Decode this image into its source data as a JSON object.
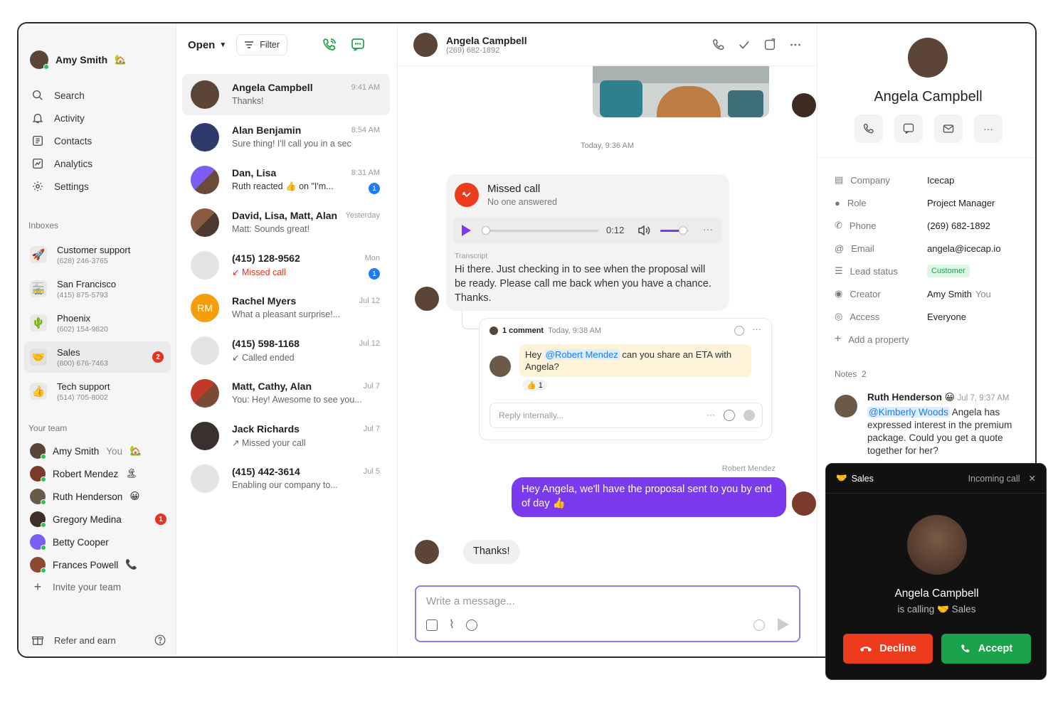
{
  "user": {
    "name": "Amy Smith",
    "status_emoji": "🏡"
  },
  "nav": {
    "items": [
      {
        "label": "Search",
        "icon": "search-icon"
      },
      {
        "label": "Activity",
        "icon": "bell-icon"
      },
      {
        "label": "Contacts",
        "icon": "contacts-icon"
      },
      {
        "label": "Analytics",
        "icon": "analytics-icon"
      },
      {
        "label": "Settings",
        "icon": "gear-icon"
      }
    ],
    "inboxes_label": "Inboxes",
    "inboxes": [
      {
        "name": "Customer support",
        "number": "(628) 246-3765",
        "emoji": "🚀"
      },
      {
        "name": "San Francisco",
        "number": "(415) 875-5793",
        "emoji": "🚋"
      },
      {
        "name": "Phoenix",
        "number": "(602) 154-9820",
        "emoji": "🌵"
      },
      {
        "name": "Sales",
        "number": "(800) 676-7463",
        "emoji": "🤝",
        "badge": "2"
      },
      {
        "name": "Tech support",
        "number": "(514) 705-8002",
        "emoji": "👍"
      }
    ],
    "team_label": "Your team",
    "team": [
      {
        "name": "Amy Smith",
        "suffix": "You",
        "emoji": "🏡"
      },
      {
        "name": "Robert Mendez",
        "emoji": "🏝"
      },
      {
        "name": "Ruth Henderson",
        "emoji": "😀"
      },
      {
        "name": "Gregory Medina",
        "badge": "1"
      },
      {
        "name": "Betty Cooper"
      },
      {
        "name": "Frances Powell",
        "emoji": "📞"
      }
    ],
    "invite_label": "Invite your team",
    "refer_label": "Refer and earn"
  },
  "list": {
    "filter_dropdown": "Open",
    "filter_button": "Filter",
    "conversations": [
      {
        "title": "Angela Campbell",
        "time": "9:41 AM",
        "preview": "Thanks!"
      },
      {
        "title": "Alan Benjamin",
        "time": "8:54 AM",
        "preview": "Sure thing! I'll call you in a sec"
      },
      {
        "title": "Dan, Lisa",
        "time": "8:31 AM",
        "preview": "Ruth reacted 👍 on \"I'm...",
        "badge": "1"
      },
      {
        "title": "David, Lisa, Matt, Alan",
        "time": "Yesterday",
        "preview": "Matt: Sounds great!"
      },
      {
        "title": "(415) 128-9562",
        "time": "Mon",
        "preview": "Missed call",
        "badge": "1"
      },
      {
        "title": "Rachel Myers",
        "time": "Jul 12",
        "preview": "What a pleasant surprise!...",
        "initials": "RM"
      },
      {
        "title": "(415) 598-1168",
        "time": "Jul 12",
        "preview": "Called ended"
      },
      {
        "title": "Matt, Cathy, Alan",
        "time": "Jul 7",
        "preview": "You: Hey! Awesome to see you..."
      },
      {
        "title": "Jack Richards",
        "time": "Jul 7",
        "preview": "Missed your call"
      },
      {
        "title": "(415) 442-3614",
        "time": "Jul 5",
        "preview": "Enabling our company to..."
      }
    ]
  },
  "chat": {
    "contact_name": "Angela Campbell",
    "contact_phone": "(269) 682-1892",
    "timestamp": "Today, 9:36 AM",
    "missed_call": {
      "title": "Missed call",
      "subtitle": "No one answered",
      "duration": "0:12",
      "progress": 0,
      "volume": 0.8,
      "transcript_label": "Transcript",
      "transcript": "Hi there. Just checking in to see when the proposal will be ready. Please call me back when you have a chance. Thanks."
    },
    "comment": {
      "count_label": "1 comment",
      "time": "Today, 9:38 AM",
      "text_pre": "Hey ",
      "mention": "@Robert Mendez",
      "text_post": " can you share an ETA with Angela?",
      "reaction": "👍 1",
      "reply_placeholder": "Reply internally..."
    },
    "sender_label": "Robert Mendez",
    "outgoing": "Hey Angela, we'll have the proposal sent to you by end of day 👍",
    "incoming": "Thanks!",
    "composer_placeholder": "Write a message..."
  },
  "details": {
    "name": "Angela Campbell",
    "properties": [
      {
        "key": "Company",
        "value": "Icecap",
        "icon": "building-icon"
      },
      {
        "key": "Role",
        "value": "Project Manager",
        "icon": "person-icon"
      },
      {
        "key": "Phone",
        "value": "(269) 682-1892",
        "icon": "phone-icon"
      },
      {
        "key": "Email",
        "value": "angela@icecap.io",
        "icon": "at-icon"
      },
      {
        "key": "Lead status",
        "value": "Customer",
        "icon": "list-icon"
      },
      {
        "key": "Creator",
        "value": "Amy Smith",
        "value_suffix": "You",
        "icon": "creator-icon"
      },
      {
        "key": "Access",
        "value": "Everyone",
        "icon": "eye-icon"
      }
    ],
    "add_property": "Add a property",
    "notes_label": "Notes",
    "notes_count": "2",
    "note": {
      "author": "Ruth Henderson",
      "emoji": "😀",
      "time": "Jul 7, 9:37 AM",
      "mention": "@Kimberly Woods",
      "text": " Angela has expressed interest in the premium package. Could you get a quote together for her?"
    }
  },
  "incoming_call": {
    "inbox": "Sales",
    "inbox_emoji": "🤝",
    "label": "Incoming call",
    "caller": "Angela Campbell",
    "calling_text": "is calling",
    "decline": "Decline",
    "accept": "Accept"
  },
  "colors": {
    "accent_purple": "#7c3aed",
    "missed_red": "#ec3c1d",
    "accept_green": "#1aa34a",
    "decline_red": "#ec3c1d",
    "online_green": "#2fbf56",
    "badge_blue": "#1e7cf2"
  }
}
